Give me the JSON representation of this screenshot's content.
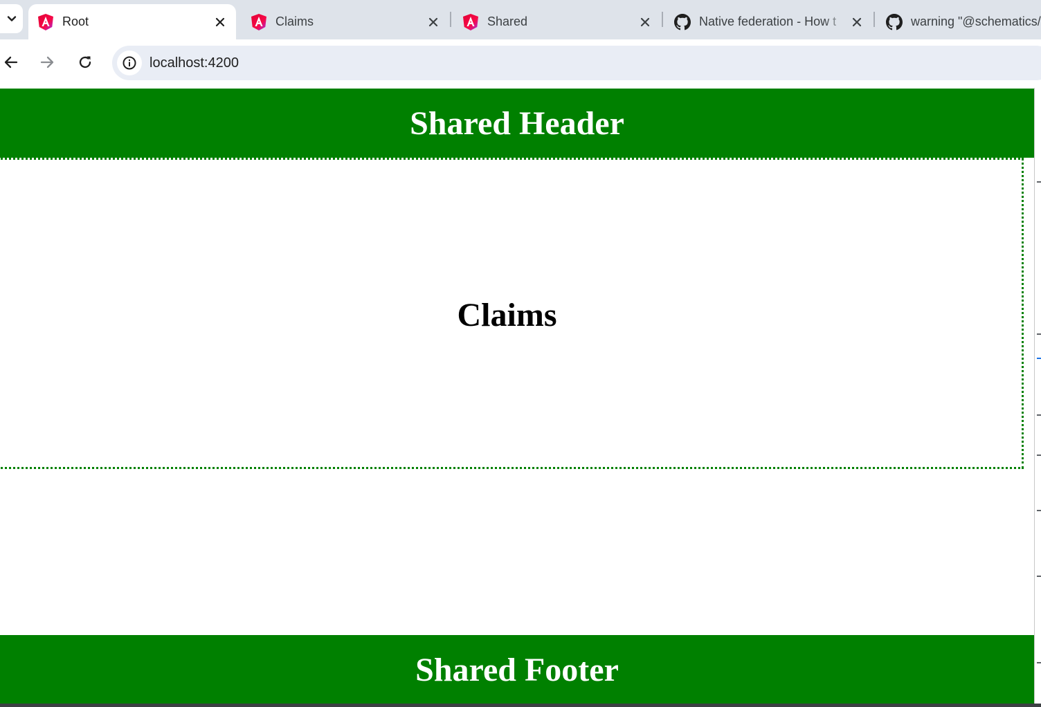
{
  "tabs": [
    {
      "title": "Root",
      "icon": "angular-icon",
      "active": true
    },
    {
      "title": "Claims",
      "icon": "angular-icon",
      "active": false
    },
    {
      "title": "Shared",
      "icon": "angular-icon",
      "active": false
    },
    {
      "title": "Native federation - How t",
      "icon": "github-icon",
      "active": false
    },
    {
      "title": "warning \"@schematics/",
      "icon": "github-icon",
      "active": false
    }
  ],
  "toolbar": {
    "url": "localhost:4200",
    "icons": [
      "back-arrow-icon",
      "forward-arrow-icon",
      "reload-icon",
      "site-info-icon"
    ]
  },
  "page": {
    "header_text": "Shared Header",
    "content_title": "Claims",
    "footer_text": "Shared Footer"
  },
  "colors": {
    "tab_strip": "#dee3ea",
    "omnibox": "#e9edf5",
    "brand_green": "#008000",
    "angular_magenta": "#e40035",
    "angular_pink": "#c2187a"
  }
}
